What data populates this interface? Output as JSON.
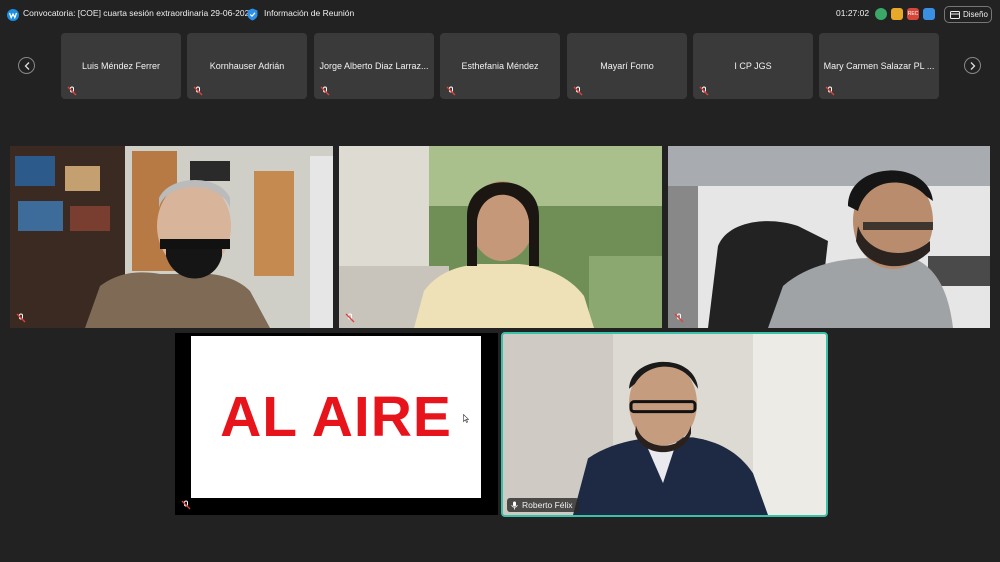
{
  "header": {
    "title": "Convocatoria: [COE] cuarta sesión extraordinaria 29-06-2026",
    "info_label": "Información de Reunión",
    "timer": "01:27:02",
    "layout_label": "Diseño"
  },
  "participants": [
    {
      "name": "Luis Méndez Ferrer"
    },
    {
      "name": "Kornhauser Adrián"
    },
    {
      "name": "Jorge Alberto Diaz Larraz..."
    },
    {
      "name": "Esthefania Méndez"
    },
    {
      "name": "Mayarí Forno"
    },
    {
      "name": "I CP JGS"
    },
    {
      "name": "Mary Carmen Salazar PL ..."
    }
  ],
  "stage": {
    "on_air_text": "AL AIRE",
    "speaker_name": "Roberto Félix"
  },
  "colors": {
    "background": "#222222",
    "tile": "#3a3a3a",
    "active_border": "#39c2a8",
    "on_air_red": "#e8141b"
  }
}
